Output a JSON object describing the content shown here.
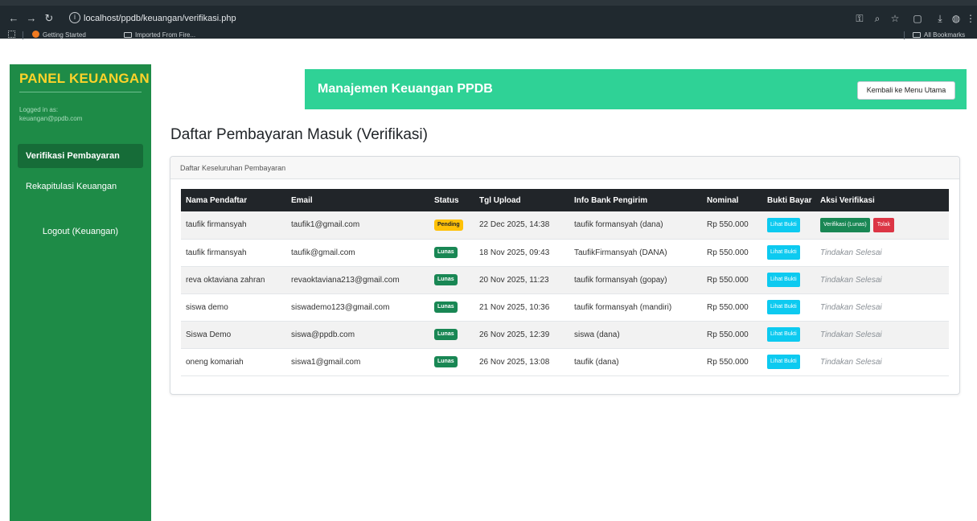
{
  "browser": {
    "url": "localhost/ppdb/keuangan/verifikasi.php",
    "bookmarks": [
      "Getting Started",
      "Imported From Fire..."
    ],
    "all_bookmarks": "All Bookmarks"
  },
  "sidebar": {
    "brand": "PANEL KEUANGAN",
    "logged_in_label": "Logged in as:",
    "logged_in_email": "keuangan@ppdb.com",
    "items": [
      {
        "label": "Verifikasi Pembayaran",
        "active": true
      },
      {
        "label": "Rekapitulasi Keuangan",
        "active": false
      }
    ],
    "logout": "Logout (Keuangan)"
  },
  "header": {
    "title": "Manajemen Keuangan PPDB",
    "back_button": "Kembali ke Menu Utama"
  },
  "main": {
    "page_title": "Daftar Pembayaran Masuk (Verifikasi)",
    "card_title": "Daftar Keseluruhan Pembayaran",
    "columns": [
      "Nama Pendaftar",
      "Email",
      "Status",
      "Tgl Upload",
      "Info Bank Pengirim",
      "Nominal",
      "Bukti Bayar",
      "Aksi Verifikasi"
    ],
    "rows": [
      {
        "name": "taufik firmansyah",
        "email": "taufik1@gmail.com",
        "status": "Pending",
        "status_kind": "pending",
        "date": "22 Dec 2025, 14:38",
        "bank": "taufik formansyah (dana)",
        "nominal": "Rp 550.000",
        "bukti": "Lihat Bukti",
        "action": "buttons"
      },
      {
        "name": "taufik firmansyah",
        "email": "taufik@gmail.com",
        "status": "Lunas",
        "status_kind": "lunas",
        "date": "18 Nov 2025, 09:43",
        "bank": "TaufikFirmansyah (DANA)",
        "nominal": "Rp 550.000",
        "bukti": "Lihat Bukti",
        "action": "done"
      },
      {
        "name": "reva oktaviana zahran",
        "email": "revaoktaviana213@gmail.com",
        "status": "Lunas",
        "status_kind": "lunas",
        "date": "20 Nov 2025, 11:23",
        "bank": "taufik formansyah (gopay)",
        "nominal": "Rp 550.000",
        "bukti": "Lihat Bukti",
        "action": "done"
      },
      {
        "name": "siswa demo",
        "email": "siswademo123@gmail.com",
        "status": "Lunas",
        "status_kind": "lunas",
        "date": "21 Nov 2025, 10:36",
        "bank": "taufik formansyah (mandiri)",
        "nominal": "Rp 550.000",
        "bukti": "Lihat Bukti",
        "action": "done"
      },
      {
        "name": "Siswa Demo",
        "email": "siswa@ppdb.com",
        "status": "Lunas",
        "status_kind": "lunas",
        "date": "26 Nov 2025, 12:39",
        "bank": "siswa (dana)",
        "nominal": "Rp 550.000",
        "bukti": "Lihat Bukti",
        "action": "done"
      },
      {
        "name": "oneng komariah",
        "email": "siswa1@gmail.com",
        "status": "Lunas",
        "status_kind": "lunas",
        "date": "26 Nov 2025, 13:08",
        "bank": "taufik (dana)",
        "nominal": "Rp 550.000",
        "bukti": "Lihat Bukti",
        "action": "done"
      }
    ],
    "verify_button": "Verifikasi (Lunas)",
    "reject_button": "Tolak",
    "done_text": "Tindakan Selesai"
  }
}
